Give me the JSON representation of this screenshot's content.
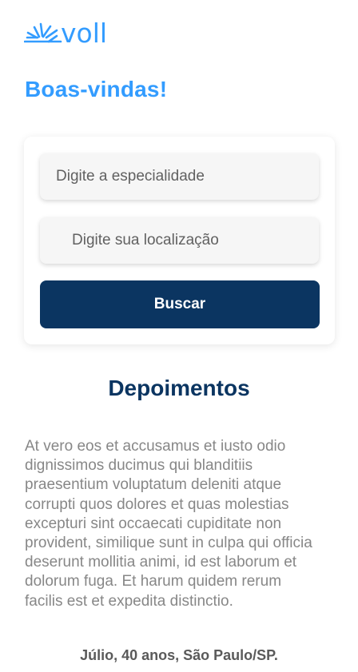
{
  "header": {
    "logo_text": "voll",
    "brand_color": "#339cff"
  },
  "welcome": {
    "title": "Boas-vindas!"
  },
  "search": {
    "specialty_placeholder": "Digite a especialidade",
    "location_placeholder": "Digite sua localização",
    "button_label": "Buscar",
    "button_color": "#0b3561"
  },
  "testimonials": {
    "title": "Depoimentos",
    "items": [
      {
        "text": "At vero eos et accusamus et iusto odio dignissimos ducimus qui blanditiis praesentium voluptatum deleniti atque corrupti quos dolores et quas molestias excepturi sint occaecati cupiditate non provident, similique sunt in culpa qui officia deserunt mollitia animi, id est laborum et dolorum fuga. Et harum quidem rerum facilis est et expedita distinctio.",
        "author": "Júlio, 40 anos, São Paulo/SP."
      }
    ]
  }
}
